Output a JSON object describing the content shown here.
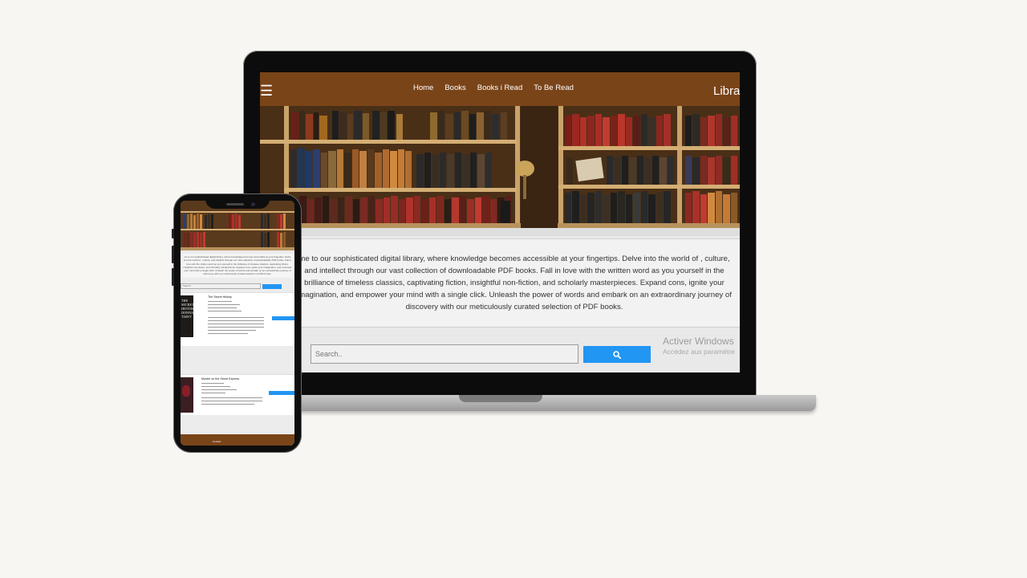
{
  "nav": {
    "links": [
      "Home",
      "Books",
      "Books i Read",
      "To Be Read"
    ],
    "brand": "Librar"
  },
  "intro": {
    "text": "me to our sophisticated digital library, where knowledge becomes accessible at your fingertips. Delve into the world of , culture, and intellect through our vast collection of downloadable PDF books. Fall in love with the written word as you yourself in the brilliance of timeless classics, captivating fiction, insightful non-fiction, and scholarly masterpieces. Expand cons, ignite your imagination, and empower your mind with a single click. Unleash the power of words and embark on an extraordinary journey of discovery with our meticulously curated selection of PDF books."
  },
  "search": {
    "placeholder": "Search.."
  },
  "watermark": {
    "title": "Activer Windows",
    "subtitle": "Accédez aux paramètre"
  },
  "phone": {
    "books": [
      {
        "title": "The Secret History",
        "cover_text": "THE SECRET HISTORY DONNA TARTT"
      },
      {
        "title": "Murder on the Orient Express",
        "cover_text": ""
      }
    ],
    "footer": "Contact"
  },
  "colors": {
    "nav_brown": "#7a4419",
    "accent_blue": "#2196f3"
  }
}
